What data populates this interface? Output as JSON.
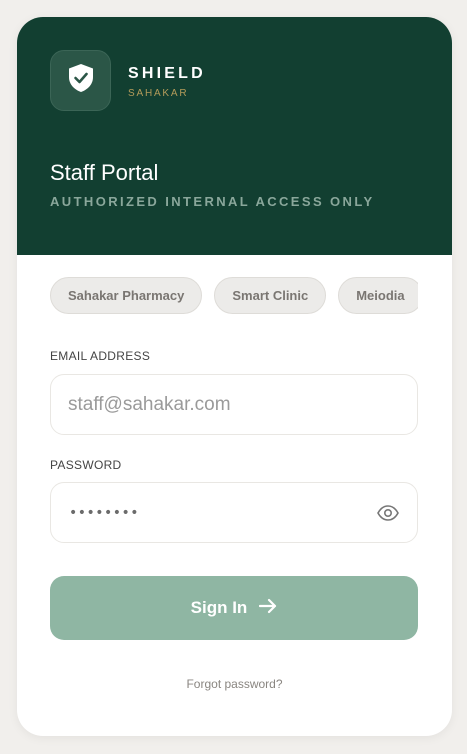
{
  "brand": {
    "name": "SHIELD",
    "sub": "SAHAKAR",
    "logo_icon": "shield-check-icon"
  },
  "portal": {
    "title": "Staff Portal",
    "subtitle": "AUTHORIZED INTERNAL ACCESS ONLY"
  },
  "chips": [
    "Sahakar Pharmacy",
    "Smart Clinic",
    "Meiodia"
  ],
  "email": {
    "label": "EMAIL ADDRESS",
    "placeholder": "staff@sahakar.com",
    "value": ""
  },
  "password": {
    "label": "PASSWORD",
    "masked": "••••••••",
    "toggle_icon": "eye-icon"
  },
  "signin": {
    "label": "Sign In",
    "icon": "arrow-right-icon"
  },
  "forgot": "Forgot password?",
  "colors": {
    "header_bg": "#123f31",
    "accent_gold": "#b39b5a",
    "button_bg": "#8fb6a3",
    "page_bg": "#f1efec"
  }
}
